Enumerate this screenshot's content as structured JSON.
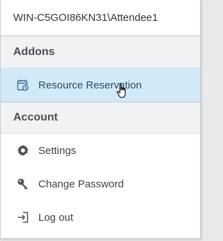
{
  "user": {
    "name": "WIN-C5GOI86KN31\\Attendee1"
  },
  "addons": {
    "header": "Addons",
    "items": [
      {
        "label": "Resource Reservation",
        "icon": "calendar-clock-icon"
      }
    ]
  },
  "account": {
    "header": "Account",
    "items": [
      {
        "label": "Settings",
        "icon": "gear-icon"
      },
      {
        "label": "Change Password",
        "icon": "key-icon"
      },
      {
        "label": "Log out",
        "icon": "logout-icon"
      }
    ]
  },
  "colors": {
    "active_bg": "#d2e9f8",
    "icon_color": "#4b5259",
    "active_icon_color": "#3a6e96"
  }
}
